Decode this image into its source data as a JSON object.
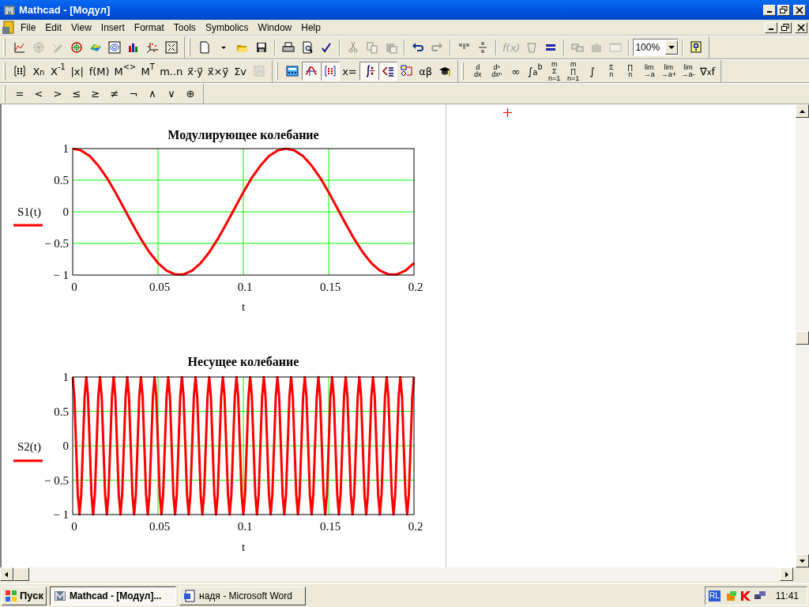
{
  "window": {
    "title": "Mathcad - [Модул]"
  },
  "menu": [
    "File",
    "Edit",
    "View",
    "Insert",
    "Format",
    "Tools",
    "Symbolics",
    "Window",
    "Help"
  ],
  "toolbar_rows": [
    [
      {
        "groups": [
          [
            {
              "kind": "icon",
              "disabled": false
            },
            {
              "kind": "icon",
              "disabled": true
            },
            {
              "kind": "icon",
              "disabled": true
            },
            {
              "kind": "icon",
              "disabled": false
            },
            {
              "kind": "icon",
              "disabled": false
            },
            {
              "kind": "icon",
              "disabled": false
            },
            {
              "kind": "icon",
              "disabled": false
            },
            {
              "kind": "icon",
              "disabled": false
            },
            {
              "kind": "icon",
              "disabled": false
            }
          ]
        ]
      },
      {
        "groups": [
          [
            {
              "kind": "icon",
              "disabled": false
            },
            {
              "kind": "icon",
              "disabled": false
            },
            {
              "kind": "icon",
              "disabled": false
            },
            {
              "kind": "icon",
              "disabled": false
            }
          ],
          [
            {
              "kind": "icon",
              "disabled": false
            },
            {
              "kind": "icon",
              "disabled": false
            },
            {
              "kind": "icon",
              "disabled": false
            }
          ],
          [
            {
              "kind": "icon",
              "disabled": true
            },
            {
              "kind": "icon",
              "disabled": true
            },
            {
              "kind": "icon",
              "disabled": true
            }
          ],
          [
            {
              "kind": "icon",
              "disabled": false
            },
            {
              "kind": "icon",
              "disabled": true
            }
          ],
          [
            {
              "kind": "icon",
              "disabled": true
            },
            {
              "kind": "icon",
              "disabled": true
            }
          ],
          [
            {
              "kind": "text",
              "label": "f(x)",
              "disabled": true
            },
            {
              "kind": "icon",
              "disabled": true
            },
            {
              "kind": "icon",
              "disabled": false
            }
          ],
          [
            {
              "kind": "icon",
              "disabled": true
            },
            {
              "kind": "icon",
              "disabled": true
            },
            {
              "kind": "icon",
              "disabled": true
            }
          ],
          [
            {
              "kind": "combo",
              "value": "100%",
              "disabled": false
            }
          ],
          [
            {
              "kind": "icon",
              "disabled": false
            }
          ]
        ]
      }
    ],
    [
      {
        "groups": [
          [
            {
              "kind": "icon",
              "disabled": false
            },
            {
              "kind": "text",
              "label": "X$_{n}$",
              "disabled": false
            },
            {
              "kind": "text",
              "label": "X$^{-1}$",
              "disabled": false
            },
            {
              "kind": "text",
              "label": "|x|",
              "disabled": false
            },
            {
              "kind": "text",
              "label": "f(M)",
              "disabled": false
            },
            {
              "kind": "text",
              "label": "M$^{<>}$",
              "disabled": false
            },
            {
              "kind": "text",
              "label": "M$^{T}$",
              "disabled": false
            },
            {
              "kind": "text",
              "label": "m..n",
              "disabled": false
            },
            {
              "kind": "text",
              "label": "x⃗·y⃗",
              "disabled": false
            },
            {
              "kind": "text",
              "label": "x⃗×y⃗",
              "disabled": false
            },
            {
              "kind": "text",
              "label": "Σv",
              "disabled": false
            },
            {
              "kind": "icon",
              "disabled": true
            }
          ]
        ]
      },
      {
        "groups": [
          [
            {
              "kind": "icon",
              "selected": false
            },
            {
              "kind": "icon",
              "selected": true
            },
            {
              "kind": "icon",
              "selected": true
            },
            {
              "kind": "text",
              "label": "x=",
              "selected": false
            },
            {
              "kind": "icon",
              "selected": true
            },
            {
              "kind": "icon",
              "selected": true
            },
            {
              "kind": "icon",
              "selected": false
            },
            {
              "kind": "text",
              "label": "αβ",
              "selected": false
            },
            {
              "kind": "icon",
              "selected": false
            }
          ]
        ]
      },
      {
        "groups": [
          [
            {
              "kind": "stack",
              "lines": [
                "d",
                "dx"
              ]
            },
            {
              "kind": "stack",
              "lines": [
                "dⁿ",
                "dxⁿ"
              ]
            },
            {
              "kind": "text",
              "label": "∞"
            },
            {
              "kind": "text",
              "label": "∫$_{a}$$^{b}$"
            },
            {
              "kind": "stack",
              "lines": [
                "m",
                "Σ",
                "n=1"
              ]
            },
            {
              "kind": "stack",
              "lines": [
                "m",
                "∏",
                "n=1"
              ]
            },
            {
              "kind": "text",
              "label": "∫"
            },
            {
              "kind": "stack",
              "lines": [
                "Σ",
                "n"
              ]
            },
            {
              "kind": "stack",
              "lines": [
                "∏",
                "n"
              ]
            },
            {
              "kind": "stack",
              "lines": [
                "lim",
                "→a"
              ]
            },
            {
              "kind": "stack",
              "lines": [
                "lim",
                "→a+"
              ]
            },
            {
              "kind": "stack",
              "lines": [
                "lim",
                "→a-"
              ]
            },
            {
              "kind": "text",
              "label": "∇$_{x}$f"
            }
          ]
        ]
      }
    ],
    [
      {
        "groups": [
          [
            {
              "kind": "text",
              "label": "="
            },
            {
              "kind": "text",
              "label": "<"
            },
            {
              "kind": "text",
              "label": ">"
            },
            {
              "kind": "text",
              "label": "≤"
            },
            {
              "kind": "text",
              "label": "≥"
            },
            {
              "kind": "text",
              "label": "≠"
            },
            {
              "kind": "text",
              "label": "¬"
            },
            {
              "kind": "text",
              "label": "∧"
            },
            {
              "kind": "text",
              "label": "∨"
            },
            {
              "kind": "text",
              "label": "⊕"
            }
          ]
        ]
      }
    ]
  ],
  "plots": [
    {
      "chart_data": {
        "type": "line",
        "grid": true,
        "title": "Модулирующее колебание",
        "xlabel": "t",
        "x": [
          0,
          0.005,
          0.01,
          0.015,
          0.02,
          0.025,
          0.03,
          0.035,
          0.04,
          0.045,
          0.05,
          0.055,
          0.06,
          0.065,
          0.07,
          0.075,
          0.08,
          0.085,
          0.09,
          0.095,
          0.1,
          0.105,
          0.11,
          0.115,
          0.12,
          0.125,
          0.13,
          0.135,
          0.14,
          0.145,
          0.15,
          0.155,
          0.16,
          0.165,
          0.17,
          0.175,
          0.18,
          0.185,
          0.19,
          0.195,
          0.2
        ],
        "series": [
          {
            "name": "S1(t)",
            "color": "#ff0000",
            "values": [
              1,
              0.97,
              0.88,
              0.73,
              0.54,
              0.31,
              0.06,
              -0.19,
              -0.43,
              -0.64,
              -0.81,
              -0.93,
              -0.99,
              -0.99,
              -0.93,
              -0.81,
              -0.64,
              -0.43,
              -0.19,
              0.06,
              0.31,
              0.54,
              0.73,
              0.88,
              0.97,
              1,
              0.97,
              0.88,
              0.73,
              0.54,
              0.31,
              0.06,
              -0.19,
              -0.43,
              -0.64,
              -0.81,
              -0.93,
              -0.99,
              -0.99,
              -0.93,
              -0.81
            ]
          }
        ],
        "xlim": [
          0,
          0.2
        ],
        "ylim": [
          -1,
          1
        ],
        "xticks": [
          0,
          0.05,
          0.1,
          0.15,
          0.2
        ],
        "yticks": [
          {
            "value": 1,
            "label": "1"
          },
          {
            "value": 0.5,
            "label": "0.5"
          },
          {
            "value": 0,
            "label": "0"
          },
          {
            "value": -0.5,
            "label": "− 0.5"
          },
          {
            "value": -1,
            "label": "− 1"
          }
        ]
      }
    },
    {
      "chart_data": {
        "type": "line",
        "grid": true,
        "title": "Несущее колебание",
        "xlabel": "t",
        "x": [
          0,
          0.001,
          0.002,
          0.003,
          0.004,
          0.005,
          0.006,
          0.007,
          0.008,
          0.009,
          0.01,
          0.011,
          0.012,
          0.013,
          0.014,
          0.015,
          0.016,
          0.017,
          0.018,
          0.019,
          0.02,
          0.021,
          0.022,
          0.023,
          0.024,
          0.025,
          0.026,
          0.027,
          0.028,
          0.029,
          0.03,
          0.031,
          0.032,
          0.033,
          0.034,
          0.035,
          0.036,
          0.037,
          0.038,
          0.039,
          0.04,
          0.041,
          0.042,
          0.043,
          0.044,
          0.045,
          0.046,
          0.047,
          0.048,
          0.049,
          0.05,
          0.051,
          0.052,
          0.053,
          0.054,
          0.055,
          0.056,
          0.057,
          0.058,
          0.059,
          0.06,
          0.061,
          0.062,
          0.063,
          0.064,
          0.065,
          0.066,
          0.067,
          0.068,
          0.069,
          0.07,
          0.071,
          0.072,
          0.073,
          0.074,
          0.075,
          0.076,
          0.077,
          0.078,
          0.079,
          0.08,
          0.081,
          0.082,
          0.083,
          0.084,
          0.085,
          0.086,
          0.087,
          0.088,
          0.089,
          0.09,
          0.091,
          0.092,
          0.093,
          0.094,
          0.095,
          0.096,
          0.097,
          0.098,
          0.099,
          0.1,
          0.101,
          0.102,
          0.103,
          0.104,
          0.105,
          0.106,
          0.107,
          0.108,
          0.109,
          0.11,
          0.111,
          0.112,
          0.113,
          0.114,
          0.115,
          0.116,
          0.117,
          0.118,
          0.119,
          0.12,
          0.121,
          0.122,
          0.123,
          0.124,
          0.125,
          0.126,
          0.127,
          0.128,
          0.129,
          0.13,
          0.131,
          0.132,
          0.133,
          0.134,
          0.135,
          0.136,
          0.137,
          0.138,
          0.139,
          0.14,
          0.141,
          0.142,
          0.143,
          0.144,
          0.145,
          0.146,
          0.147,
          0.148,
          0.149,
          0.15,
          0.151,
          0.152,
          0.153,
          0.154,
          0.155,
          0.156,
          0.157,
          0.158,
          0.159,
          0.16,
          0.161,
          0.162,
          0.163,
          0.164,
          0.165,
          0.166,
          0.167,
          0.168,
          0.169,
          0.17,
          0.171,
          0.172,
          0.173,
          0.174,
          0.175,
          0.176,
          0.177,
          0.178,
          0.179,
          0.18,
          0.181,
          0.182,
          0.183,
          0.184,
          0.185,
          0.186,
          0.187,
          0.188,
          0.189,
          0.19,
          0.191,
          0.192,
          0.193,
          0.194,
          0.195,
          0.196,
          0.197,
          0.198,
          0.199,
          0.2
        ],
        "series": [
          {
            "name": "S2(t)",
            "color": "#ff0000",
            "values": [
              1,
              0.71,
              0,
              -0.71,
              -1,
              -0.71,
              0,
              0.71,
              1,
              0.71,
              0,
              -0.71,
              -1,
              -0.71,
              0,
              0.71,
              1,
              0.71,
              0,
              -0.71,
              -1,
              -0.71,
              0,
              0.71,
              1,
              0.71,
              0,
              -0.71,
              -1,
              -0.71,
              0,
              0.71,
              1,
              0.71,
              0,
              -0.71,
              -1,
              -0.71,
              0,
              0.71,
              1,
              0.71,
              0,
              -0.71,
              -1,
              -0.71,
              0,
              0.71,
              1,
              0.71,
              0,
              -0.71,
              -1,
              -0.71,
              0,
              0.71,
              1,
              0.71,
              0,
              -0.71,
              -1,
              -0.71,
              0,
              0.71,
              1,
              0.71,
              0,
              -0.71,
              -1,
              -0.71,
              0,
              0.71,
              1,
              0.71,
              0,
              -0.71,
              -1,
              -0.71,
              0,
              0.71,
              1,
              0.71,
              0,
              -0.71,
              -1,
              -0.71,
              0,
              0.71,
              1,
              0.71,
              0,
              -0.71,
              -1,
              -0.71,
              0,
              0.71,
              1,
              0.71,
              0,
              -0.71,
              -1,
              -0.71,
              0,
              0.71,
              1,
              0.71,
              0,
              -0.71,
              -1,
              -0.71,
              0,
              0.71,
              1,
              0.71,
              0,
              -0.71,
              -1,
              -0.71,
              0,
              0.71,
              1,
              0.71,
              0,
              -0.71,
              -1,
              -0.71,
              0,
              0.71,
              1,
              0.71,
              0,
              -0.71,
              -1,
              -0.71,
              0,
              0.71,
              1,
              0.71,
              0,
              -0.71,
              -1,
              -0.71,
              0,
              0.71,
              1,
              0.71,
              0,
              -0.71,
              -1,
              -0.71,
              0,
              0.71,
              1,
              0.71,
              0,
              -0.71,
              -1,
              -0.71,
              0,
              0.71,
              1,
              0.71,
              0,
              -0.71,
              -1,
              -0.71,
              0,
              0.71,
              1,
              0.71,
              0,
              -0.71,
              -1,
              -0.71,
              0,
              0.71,
              1,
              0.71,
              0,
              -0.71,
              -1,
              -0.71,
              0,
              0.71,
              1,
              0.71,
              0,
              -0.71,
              -1,
              -0.71,
              0,
              0.71,
              1,
              0.71,
              0,
              -0.71,
              -1,
              -0.71,
              0,
              0.71,
              1
            ]
          }
        ],
        "xlim": [
          0,
          0.2
        ],
        "ylim": [
          -1,
          1
        ],
        "xticks": [
          0,
          0.05,
          0.1,
          0.15,
          0.2
        ],
        "yticks": [
          {
            "value": 1,
            "label": "1"
          },
          {
            "value": 0.5,
            "label": "0.5"
          },
          {
            "value": 0,
            "label": "0"
          },
          {
            "value": -0.5,
            "label": "− 0.5"
          },
          {
            "value": -1,
            "label": "− 1"
          }
        ]
      }
    }
  ],
  "taskbar": {
    "start": "Пуск",
    "tasks": [
      {
        "label": "Mathcad - [Модул]...",
        "selected": true
      },
      {
        "label": "надя - Microsoft Word",
        "selected": false
      }
    ],
    "tray_badge": "RL",
    "clock": "11:41"
  }
}
